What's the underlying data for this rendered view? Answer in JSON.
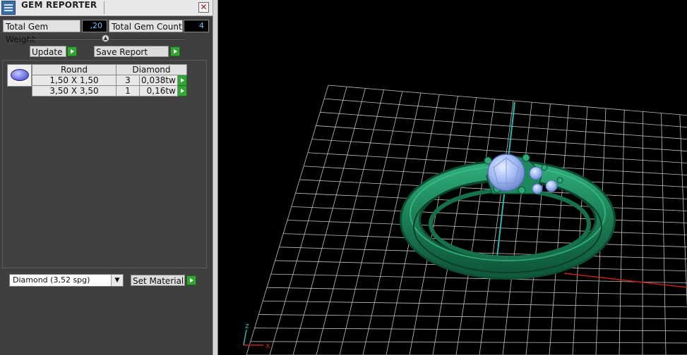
{
  "window": {
    "title": "GEM REPORTER",
    "close_glyph": "✕"
  },
  "stats": {
    "weight_label": "Total Gem Weight",
    "weight_value": ",20",
    "count_label": "Total Gem Count",
    "count_value": "4"
  },
  "actions": {
    "update_label": "Update",
    "save_label": "Save Report"
  },
  "gem_table": {
    "headers": [
      "Round",
      "Diamond"
    ],
    "rows": [
      {
        "size": "1,50 X 1,50",
        "count": "3",
        "weight": "0,038tw"
      },
      {
        "size": "3,50 X 3,50",
        "count": "1",
        "weight": "0,16tw"
      }
    ]
  },
  "material": {
    "selected": "Diamond     (3,52 spg)",
    "set_label": "Set Material"
  },
  "viewport": {
    "axis_x_label": "x",
    "axis_z_label": "z",
    "colors": {
      "grid": "#bfbfbf",
      "ring_metal": "#1d8a5e",
      "gem": "#9eb8f0",
      "x_axis": "#c0221c",
      "y_axis": "#2bb5b8"
    }
  },
  "icons": [
    "app-icon",
    "close-icon",
    "slider-thumb",
    "play-icon",
    "gem-thumbnail-icon",
    "dropdown-arrow-icon"
  ]
}
